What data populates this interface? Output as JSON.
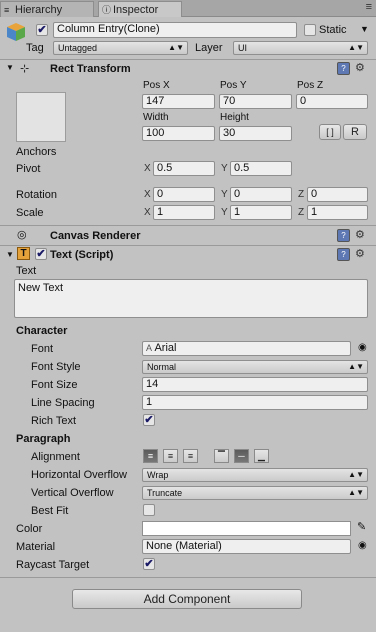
{
  "tabs": {
    "hierarchy": "Hierarchy",
    "inspector": "Inspector"
  },
  "header": {
    "object_name": "Column Entry(Clone)",
    "static_label": "Static",
    "tag_label": "Tag",
    "tag_value": "Untagged",
    "layer_label": "Layer",
    "layer_value": "UI"
  },
  "rect_transform": {
    "title": "Rect Transform",
    "pos_x_label": "Pos X",
    "pos_y_label": "Pos Y",
    "pos_z_label": "Pos Z",
    "pos_x": "147",
    "pos_y": "70",
    "pos_z": "0",
    "width_label": "Width",
    "height_label": "Height",
    "width": "100",
    "height": "30",
    "r_button": "R",
    "anchors_label": "Anchors",
    "pivot_label": "Pivot",
    "pivot_x": "0.5",
    "pivot_y": "0.5",
    "rotation_label": "Rotation",
    "rot_x": "0",
    "rot_y": "0",
    "rot_z": "0",
    "scale_label": "Scale",
    "scale_x": "1",
    "scale_y": "1",
    "scale_z": "1",
    "axis_x": "X",
    "axis_y": "Y",
    "axis_z": "Z"
  },
  "canvas_renderer": {
    "title": "Canvas Renderer"
  },
  "text_script": {
    "title": "Text (Script)",
    "text_label": "Text",
    "text_value": "New Text",
    "character_heading": "Character",
    "font_label": "Font",
    "font_value": "Arial",
    "font_style_label": "Font Style",
    "font_style_value": "Normal",
    "font_size_label": "Font Size",
    "font_size_value": "14",
    "line_spacing_label": "Line Spacing",
    "line_spacing_value": "1",
    "rich_text_label": "Rich Text",
    "paragraph_heading": "Paragraph",
    "alignment_label": "Alignment",
    "h_overflow_label": "Horizontal Overflow",
    "h_overflow_value": "Wrap",
    "v_overflow_label": "Vertical Overflow",
    "v_overflow_value": "Truncate",
    "best_fit_label": "Best Fit",
    "color_label": "Color",
    "color_value": "#ffffff",
    "material_label": "Material",
    "material_value": "None (Material)",
    "raycast_label": "Raycast Target"
  },
  "add_component": "Add Component"
}
